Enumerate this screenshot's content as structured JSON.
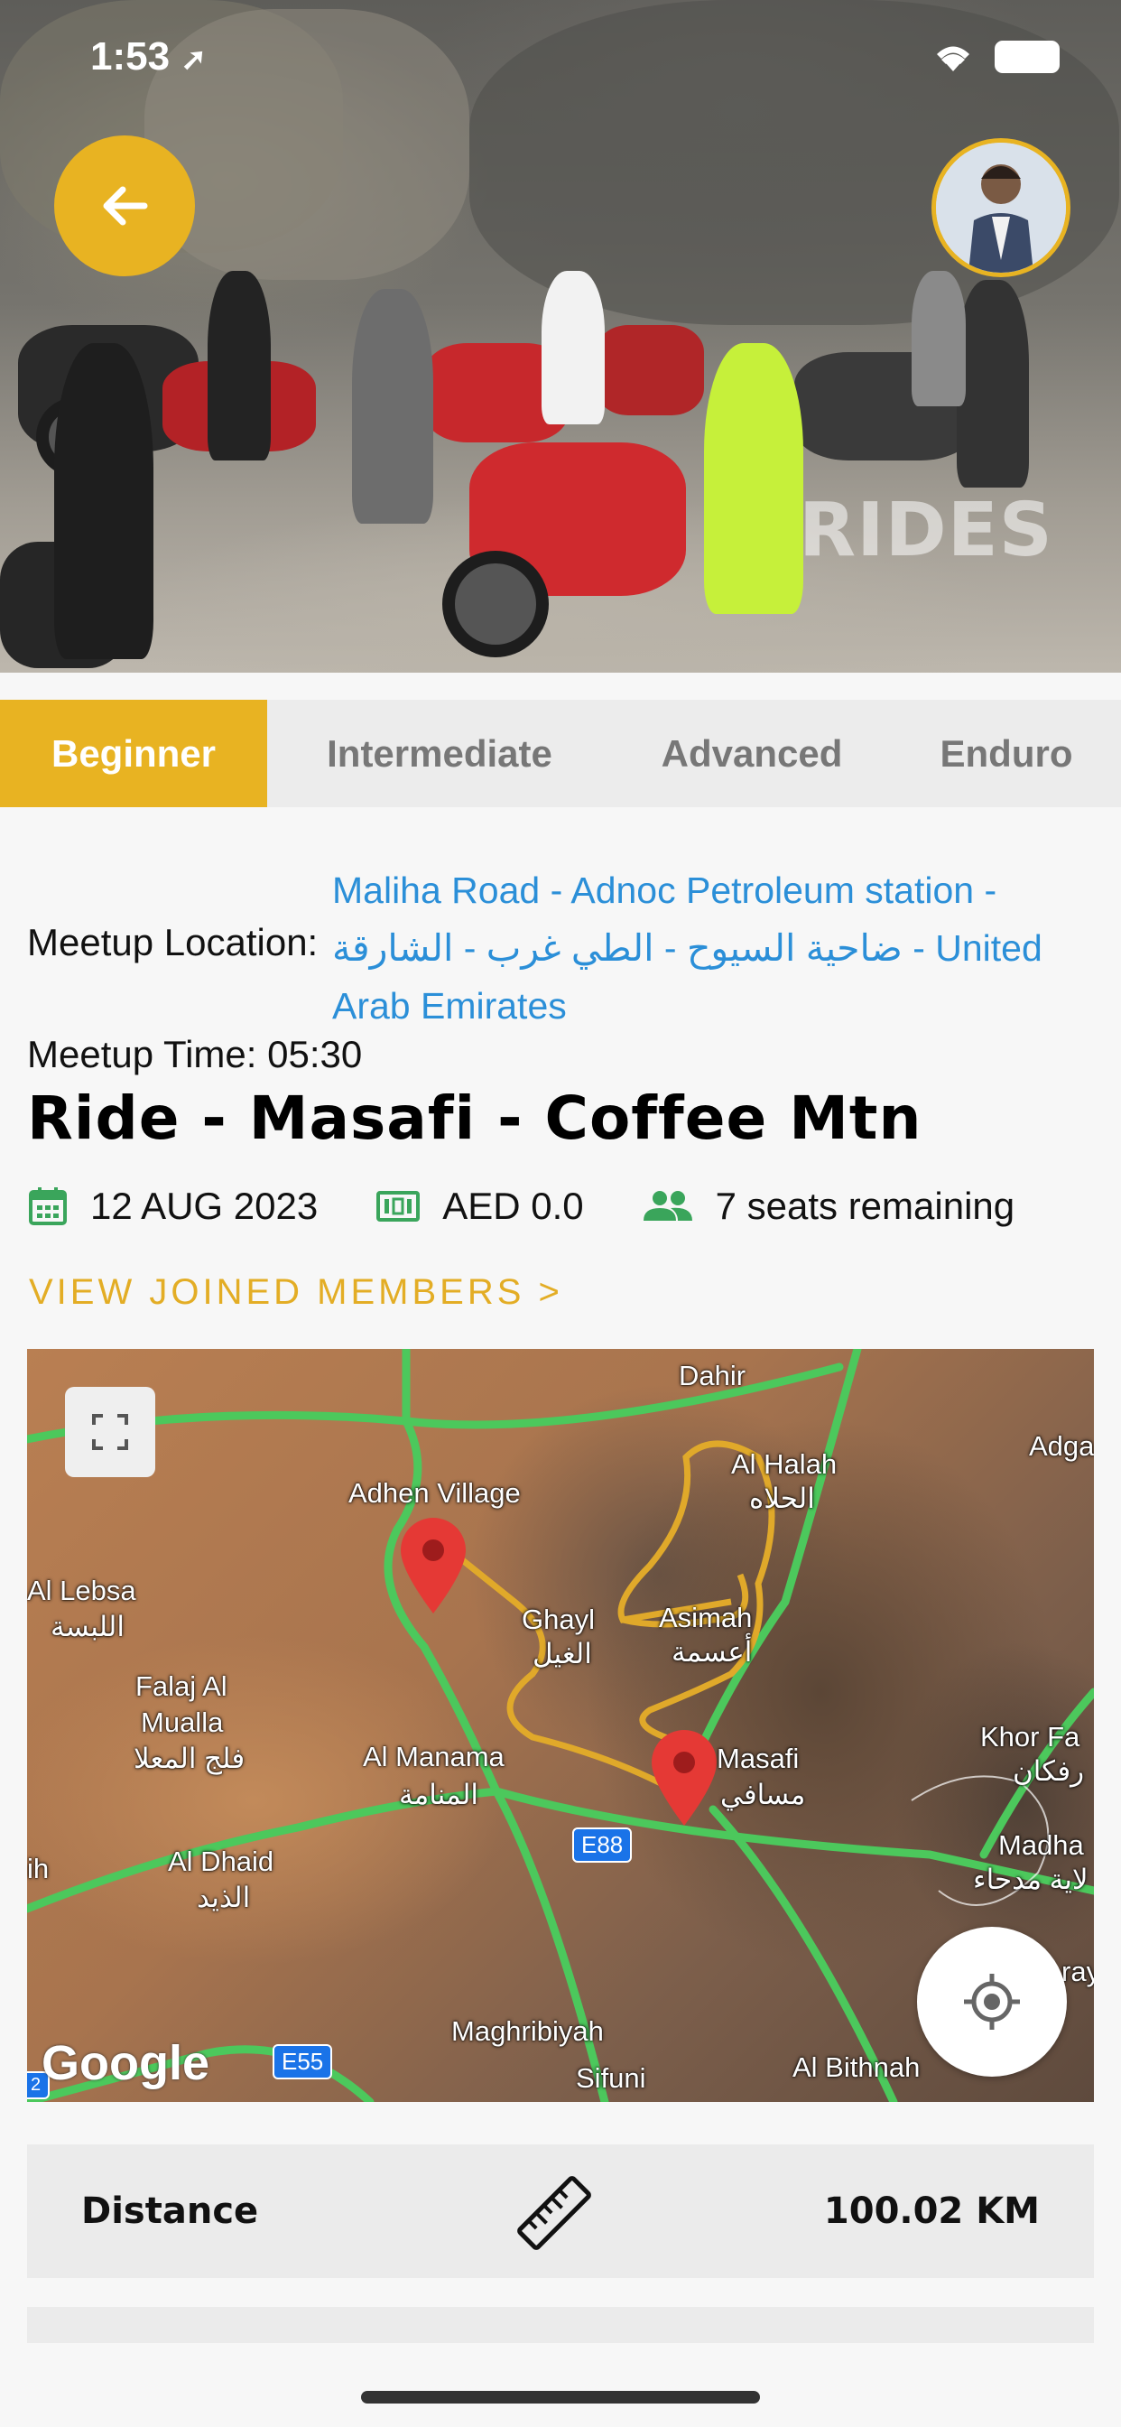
{
  "status_bar": {
    "time": "1:53"
  },
  "hero": {
    "watermark": "RIDES"
  },
  "tabs": [
    {
      "label": "Beginner",
      "active": true
    },
    {
      "label": "Intermediate",
      "active": false
    },
    {
      "label": "Advanced",
      "active": false
    },
    {
      "label": "Enduro",
      "active": false
    }
  ],
  "ride": {
    "meetup_location_label": "Meetup Location:",
    "meetup_location_value": "Maliha Road - Adnoc Petroleum station - ضاحية السيوح - الطي غرب - الشارقة - United Arab Emirates",
    "meetup_time": "Meetup Time: 05:30",
    "title": "Ride - Masafi - Coffee Mtn",
    "date": "12 AUG 2023",
    "price": "AED 0.0",
    "seats": "7 seats remaining",
    "view_members": "VIEW JOINED MEMBERS >"
  },
  "map": {
    "labels": {
      "dahir": "Dahir",
      "al_halah": "Al Halah",
      "al_halah_ar": "الحلاه",
      "adga": "Adga",
      "adhen_village": "Adhen Village",
      "al_lebsa": "Al Lebsa",
      "al_lebsa_ar": "اللبسة",
      "ghayl": "Ghayl",
      "ghayl_ar": "الغيل",
      "asimah": "Asimah",
      "asimah_ar": "أعسمة",
      "falaj": "Falaj Al",
      "mualla": "Mualla",
      "falaj_ar": "فلج المعلا",
      "al_manama": "Al Manama",
      "al_manama_ar": "المنامة",
      "masafi": "Masafi",
      "masafi_ar": "مسافي",
      "khor_fa": "Khor Fa",
      "khor_ar": "رفكان",
      "madha": "Madha",
      "madha_ar": "لاية مدحاء",
      "al_dhaid": "Al Dhaid",
      "al_dhaid_ar": "الذيد",
      "ih": "ih",
      "maghribiyah": "Maghribiyah",
      "sifuni": "Sifuni",
      "al_bithnah": "Al Bithnah",
      "ray": "ray"
    },
    "shields": {
      "e88": "E88",
      "e55": "E55",
      "two": "2"
    },
    "attribution": "Google"
  },
  "stats": {
    "distance_label": "Distance",
    "distance_value": "100.02 KM"
  },
  "colors": {
    "accent": "#e8b322",
    "link": "#2b8fd8",
    "icon_green": "#3aa55b"
  }
}
